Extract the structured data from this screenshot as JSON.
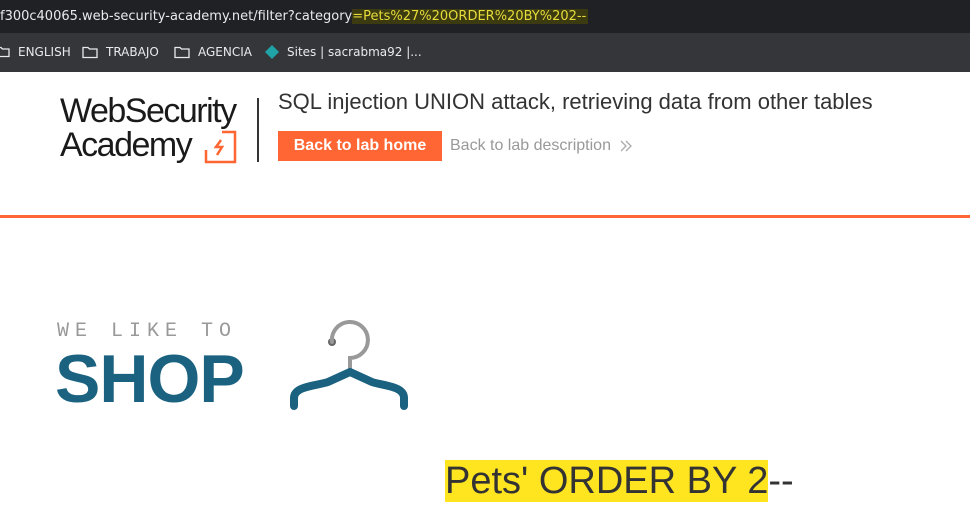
{
  "browser": {
    "url_base": "f300c40065.web-security-academy.net/filter?category",
    "url_query": "=Pets%27%20ORDER%20BY%202--",
    "bookmarks": [
      {
        "label": "ENGLISH",
        "icon": "folder-icon"
      },
      {
        "label": "TRABAJO",
        "icon": "folder-icon"
      },
      {
        "label": "AGENCIA",
        "icon": "folder-icon"
      },
      {
        "label": "Sites | sacrabma92 |...",
        "icon": "sites-diamond-icon"
      }
    ]
  },
  "header": {
    "logo_line1": "WebSecurity",
    "logo_line2": "Academy",
    "lab_title": "SQL injection UNION attack, retrieving data from other tables",
    "back_to_lab_home": "Back to lab home",
    "back_to_lab_description": "Back to lab description",
    "accent_color": "#ff6633"
  },
  "shop_logo": {
    "tagline": "WE LIKE TO",
    "name": "SHOP",
    "color": "#1b6280"
  },
  "category": {
    "highlighted": "Pets' ORDER BY 2",
    "rest": "--"
  }
}
